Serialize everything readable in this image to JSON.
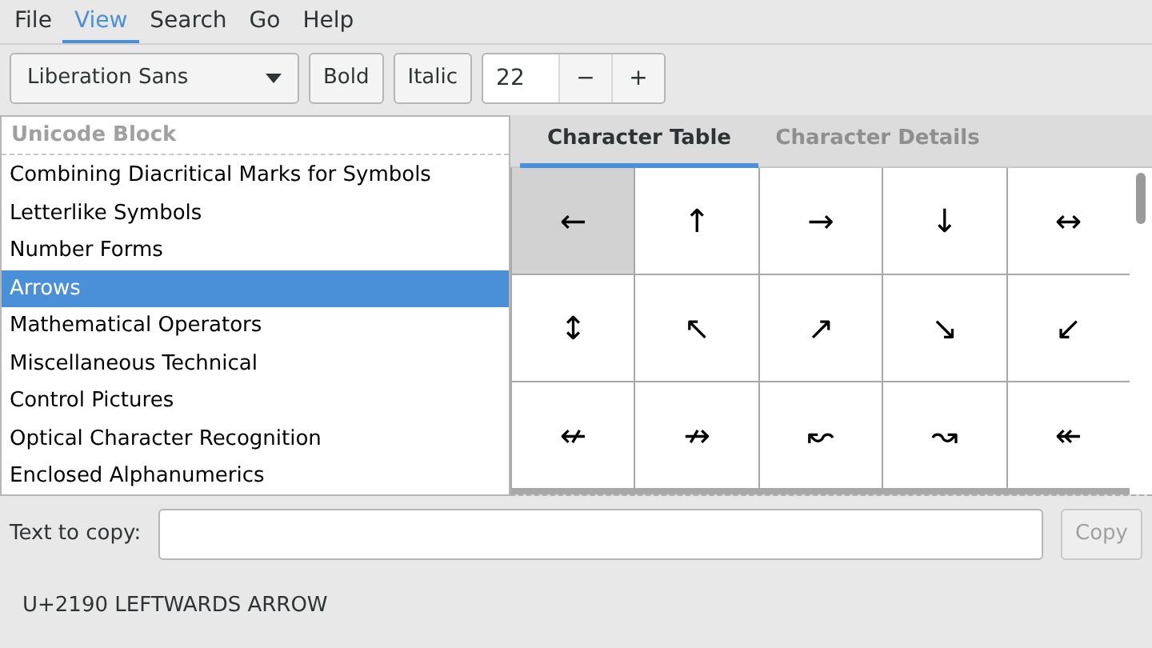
{
  "menu": [
    {
      "label": "File",
      "selected": false
    },
    {
      "label": "View",
      "selected": true
    },
    {
      "label": "Search",
      "selected": false
    },
    {
      "label": "Go",
      "selected": false
    },
    {
      "label": "Help",
      "selected": false
    }
  ],
  "toolbar": {
    "font": "Liberation Sans",
    "bold_label": "Bold",
    "italic_label": "Italic",
    "size": "22",
    "decrement": "−",
    "increment": "+"
  },
  "block_list": {
    "header": "Unicode Block",
    "items": [
      {
        "label": "Combining Diacritical Marks for Symbols",
        "selected": false
      },
      {
        "label": "Letterlike Symbols",
        "selected": false
      },
      {
        "label": "Number Forms",
        "selected": false
      },
      {
        "label": "Arrows",
        "selected": true
      },
      {
        "label": "Mathematical Operators",
        "selected": false
      },
      {
        "label": "Miscellaneous Technical",
        "selected": false
      },
      {
        "label": "Control Pictures",
        "selected": false
      },
      {
        "label": "Optical Character Recognition",
        "selected": false
      },
      {
        "label": "Enclosed Alphanumerics",
        "selected": false
      }
    ]
  },
  "tabs": [
    {
      "label": "Character Table",
      "selected": true
    },
    {
      "label": "Character Details",
      "selected": false
    }
  ],
  "characters": [
    {
      "char": "←",
      "selected": true
    },
    {
      "char": "↑",
      "selected": false
    },
    {
      "char": "→",
      "selected": false
    },
    {
      "char": "↓",
      "selected": false
    },
    {
      "char": "↔",
      "selected": false
    },
    {
      "char": "↕",
      "selected": false
    },
    {
      "char": "↖",
      "selected": false
    },
    {
      "char": "↗",
      "selected": false
    },
    {
      "char": "↘",
      "selected": false
    },
    {
      "char": "↙",
      "selected": false
    },
    {
      "char": "↚",
      "selected": false
    },
    {
      "char": "↛",
      "selected": false
    },
    {
      "char": "↜",
      "selected": false
    },
    {
      "char": "↝",
      "selected": false
    },
    {
      "char": "↞",
      "selected": false
    }
  ],
  "copy_row": {
    "label": "Text to copy:",
    "button": "Copy",
    "button_disabled": true
  },
  "status": "U+2190 LEFTWARDS ARROW"
}
